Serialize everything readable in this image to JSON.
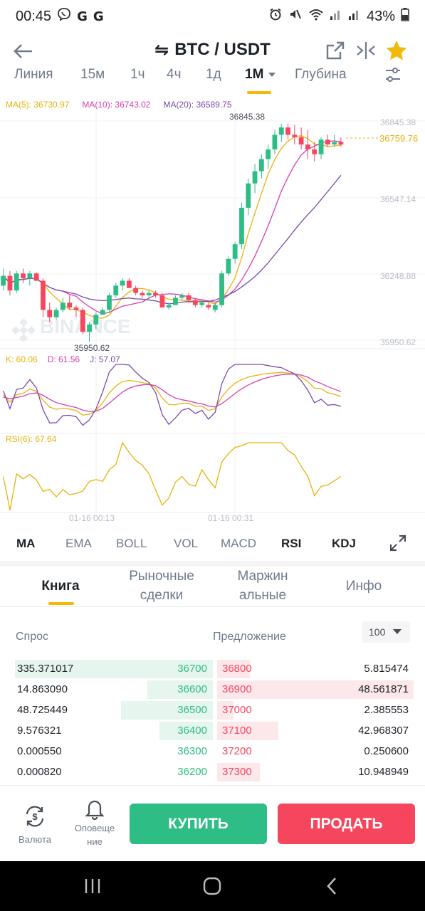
{
  "status_bar": {
    "time": "00:45",
    "g1": "G",
    "g2": "G",
    "battery": "43%"
  },
  "header": {
    "pair_arrow": "⇋",
    "pair": "BTC / USDT",
    "icons": [
      "back-arrow-icon",
      "share-external-icon",
      "compare-icon",
      "star-icon"
    ],
    "star_color": "#f0b90b"
  },
  "interval_tabs": [
    "Линия",
    "15м",
    "1ч",
    "4ч",
    "1д",
    "1М",
    "Глубина"
  ],
  "active_interval": "1М",
  "chart": {
    "ma_legend": {
      "ma5": "MA(5): 36730.97",
      "ma10": "MA(10): 36743.02",
      "ma20": "MA(20): 36589.75"
    },
    "price_ticks": [
      "36845.38",
      "36547.14",
      "36248.88",
      "35950.62"
    ],
    "current_price": "36759.76",
    "high_label": "36845.38",
    "low_label": "35950.62",
    "watermark": "BINANCE",
    "kdj_legend": {
      "k": "K: 60.06",
      "d": "D: 61.56",
      "j": "J: 57.07"
    },
    "rsi_legend": "RSI(6): 67.64",
    "time_labels": [
      "01-16 00:13",
      "01-16 00:31"
    ],
    "colors": {
      "up": "#2ebd85",
      "down": "#f6465d",
      "ma5": "#e6b30c",
      "ma10": "#d63eb0",
      "ma20": "#7a4aa8"
    }
  },
  "chart_data": {
    "type": "candlestick",
    "interval": "1m",
    "ylim": [
      35900,
      36880
    ],
    "price_ticks": [
      36845.38,
      36547.14,
      36248.88,
      35950.62
    ],
    "current_price": 36759.76,
    "candles": [
      [
        36180,
        36250,
        36160,
        36220
      ],
      [
        36220,
        36240,
        36140,
        36160
      ],
      [
        36160,
        36240,
        36150,
        36230
      ],
      [
        36230,
        36250,
        36190,
        36210
      ],
      [
        36210,
        36240,
        36180,
        36230
      ],
      [
        36230,
        36235,
        36200,
        36200
      ],
      [
        36200,
        36210,
        36050,
        36080
      ],
      [
        36080,
        36110,
        36030,
        36050
      ],
      [
        36050,
        36090,
        36040,
        36080
      ],
      [
        36080,
        36130,
        36070,
        36110
      ],
      [
        36110,
        36140,
        36080,
        36090
      ],
      [
        36090,
        36100,
        36050,
        36080
      ],
      [
        36080,
        36090,
        35980,
        35990
      ],
      [
        35990,
        36030,
        35950,
        36020
      ],
      [
        36020,
        36070,
        36000,
        36060
      ],
      [
        36060,
        36090,
        36060,
        36080
      ],
      [
        36080,
        36150,
        36070,
        36140
      ],
      [
        36140,
        36190,
        36130,
        36180
      ],
      [
        36180,
        36210,
        36160,
        36200
      ],
      [
        36200,
        36210,
        36170,
        36170
      ],
      [
        36170,
        36180,
        36140,
        36150
      ],
      [
        36150,
        36160,
        36130,
        36140
      ],
      [
        36140,
        36160,
        36120,
        36150
      ],
      [
        36150,
        36160,
        36130,
        36140
      ],
      [
        36140,
        36150,
        36090,
        36090
      ],
      [
        36090,
        36110,
        36080,
        36100
      ],
      [
        36100,
        36140,
        36100,
        36130
      ],
      [
        36130,
        36150,
        36120,
        36140
      ],
      [
        36140,
        36150,
        36110,
        36120
      ],
      [
        36120,
        36130,
        36090,
        36100
      ],
      [
        36100,
        36120,
        36090,
        36110
      ],
      [
        36100,
        36110,
        36080,
        36090
      ],
      [
        36080,
        36110,
        36070,
        36100
      ],
      [
        36100,
        36240,
        36090,
        36230
      ],
      [
        36230,
        36300,
        36220,
        36290
      ],
      [
        36290,
        36360,
        36270,
        36350
      ],
      [
        36350,
        36520,
        36330,
        36500
      ],
      [
        36500,
        36620,
        36470,
        36600
      ],
      [
        36600,
        36680,
        36560,
        36650
      ],
      [
        36650,
        36720,
        36620,
        36700
      ],
      [
        36700,
        36760,
        36660,
        36740
      ],
      [
        36740,
        36820,
        36720,
        36800
      ],
      [
        36800,
        36845,
        36770,
        36830
      ],
      [
        36830,
        36845,
        36780,
        36800
      ],
      [
        36800,
        36840,
        36760,
        36790
      ],
      [
        36790,
        36830,
        36740,
        36760
      ],
      [
        36760,
        36820,
        36700,
        36740
      ],
      [
        36740,
        36770,
        36690,
        36720
      ],
      [
        36720,
        36790,
        36700,
        36780
      ],
      [
        36780,
        36800,
        36750,
        36760
      ],
      [
        36760,
        36800,
        36750,
        36770
      ],
      [
        36770,
        36790,
        36750,
        36760
      ]
    ]
  },
  "indicator_tabs": [
    "MA",
    "EMA",
    "BOLL",
    "VOL",
    "MACD",
    "RSI",
    "KDJ"
  ],
  "book_tabs": [
    {
      "label_1": "Книга",
      "label_2": ""
    },
    {
      "label_1": "Рыночные",
      "label_2": "сделки"
    },
    {
      "label_1": "Маржин",
      "label_2": "альные"
    },
    {
      "label_1": "Инфо",
      "label_2": ""
    }
  ],
  "order_book": {
    "bid_header": "Спрос",
    "ask_header": "Предложение",
    "depth": "100",
    "rows": [
      {
        "bid_qty": "335.371017",
        "bid_price": "36700",
        "ask_price": "36800",
        "ask_qty": "5.815474",
        "bid_depth": 0.97,
        "ask_depth": 0.16
      },
      {
        "bid_qty": "14.863090",
        "bid_price": "36600",
        "ask_price": "36900",
        "ask_qty": "48.561871",
        "bid_depth": 0.32,
        "ask_depth": 0.96
      },
      {
        "bid_qty": "48.725449",
        "bid_price": "36500",
        "ask_price": "37000",
        "ask_qty": "2.385553",
        "bid_depth": 0.45,
        "ask_depth": 0.08
      },
      {
        "bid_qty": "9.576321",
        "bid_price": "36400",
        "ask_price": "37100",
        "ask_qty": "42.968307",
        "bid_depth": 0.26,
        "ask_depth": 0.3
      },
      {
        "bid_qty": "0.000550",
        "bid_price": "36300",
        "ask_price": "37200",
        "ask_qty": "0.250600",
        "bid_depth": 0.0,
        "ask_depth": 0.0
      },
      {
        "bid_qty": "0.000820",
        "bid_price": "36200",
        "ask_price": "37300",
        "ask_qty": "10.948949",
        "bid_depth": 0.0,
        "ask_depth": 0.21
      }
    ]
  },
  "action_bar": {
    "currency_label": "Валюта",
    "alerts_label_1": "Оповеще",
    "alerts_label_2": "ние",
    "buy_label": "КУПИТЬ",
    "sell_label": "ПРОДАТЬ"
  }
}
